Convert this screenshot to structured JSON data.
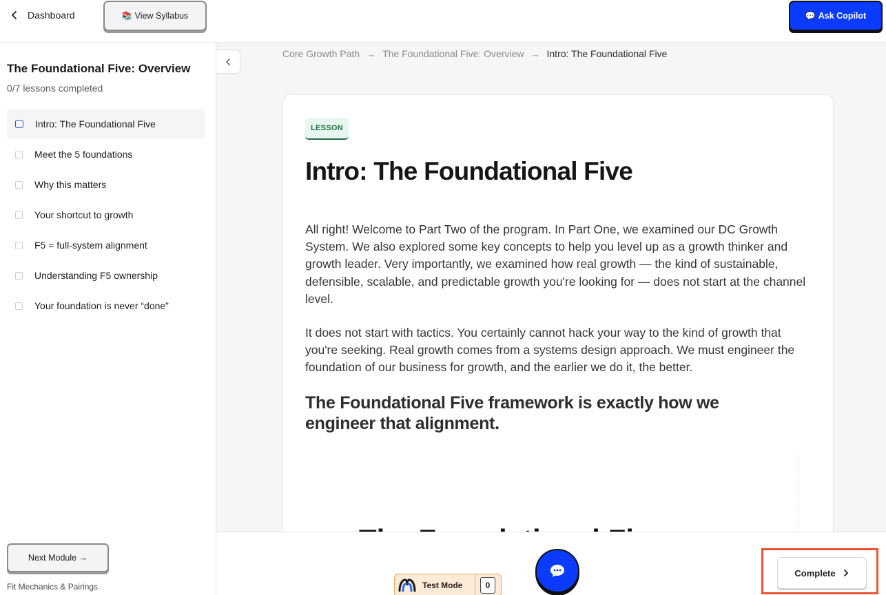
{
  "header": {
    "back_label": "Dashboard",
    "syllabus_icon": "📚",
    "syllabus_label": "View Syllabus",
    "copilot_icon": "💬",
    "copilot_label": "Ask Copilot"
  },
  "sidebar": {
    "module_title": "The Foundational Five: Overview",
    "progress_text": "0/7 lessons completed",
    "lessons": [
      {
        "label": "Intro: The Foundational Five",
        "active": true
      },
      {
        "label": "Meet the 5 foundations",
        "active": false
      },
      {
        "label": "Why this matters",
        "active": false
      },
      {
        "label": "Your shortcut to growth",
        "active": false
      },
      {
        "label": "F5 = full-system alignment",
        "active": false
      },
      {
        "label": "Understanding F5 ownership",
        "active": false
      },
      {
        "label": "Your foundation is never “done”",
        "active": false
      }
    ],
    "next_module_label": "Next Module →",
    "next_module_name": "Fit Mechanics & Pairings"
  },
  "breadcrumb": {
    "items": [
      "Core Growth Path",
      "The Foundational Five: Overview",
      "Intro: The Foundational Five"
    ],
    "separator": "→"
  },
  "lesson": {
    "badge": "LESSON",
    "title": "Intro: The Foundational Five",
    "paragraph_1": "All right! Welcome to Part Two of the program. In Part One, we examined our DC Growth System. We also explored some key concepts to help you level up as a growth thinker and growth leader. Very importantly, we examined how real growth — the kind of sustainable, defensible, scalable, and predictable growth you're looking for — does not start at the channel level.",
    "paragraph_2": "It does not start with tactics. You certainly cannot hack your way to the kind of growth that you're seeking. Real growth comes from a systems design approach. We must engineer the foundation of our business for growth, and the earlier we do it, the better.",
    "callout": "The Foundational Five framework is exactly how we engineer that alignment.",
    "partial_heading": "The Foundational Five"
  },
  "footer": {
    "test_mode_label": "Test Mode",
    "test_mode_count": "0",
    "chat_icon": "chat-bubble-icon",
    "complete_label": "Complete"
  },
  "colors": {
    "primary_blue": "#0a3bff",
    "highlight_red": "#f0502d",
    "badge_green": "#1f6b45"
  }
}
